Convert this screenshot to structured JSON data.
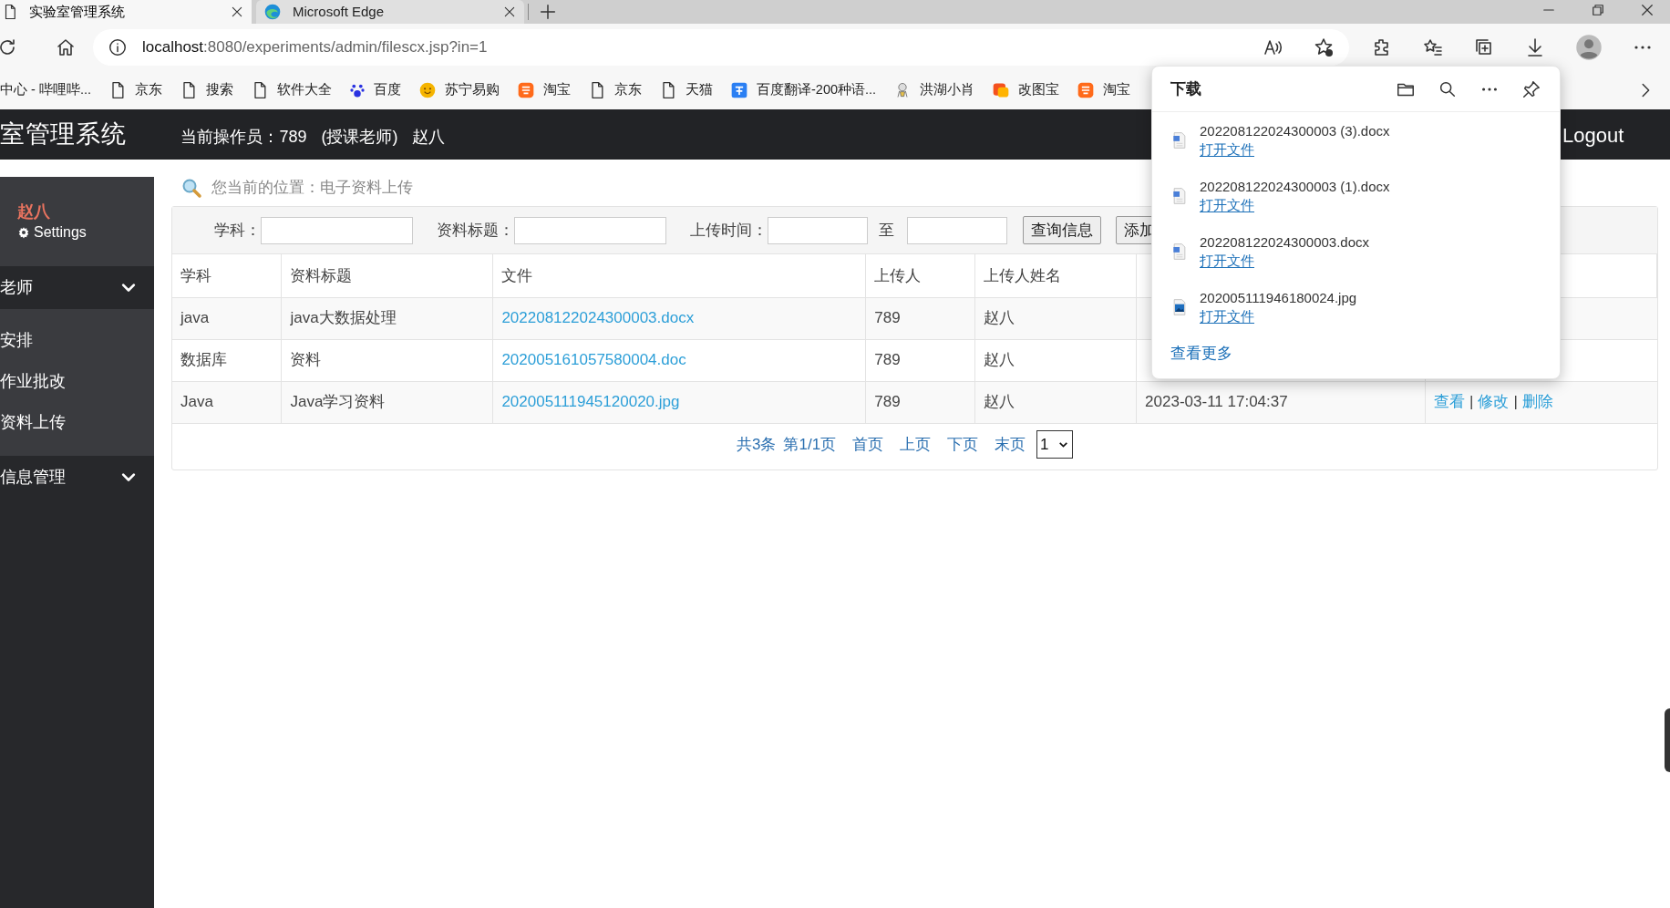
{
  "browser": {
    "tabs": [
      {
        "title": "实验室管理系统",
        "selected": true,
        "kind": "page"
      },
      {
        "title": "Microsoft Edge",
        "selected": false,
        "kind": "edge"
      }
    ],
    "address": {
      "host": "localhost",
      "path": ":8080/experiments/admin/filescx.jsp?in=1"
    },
    "bookmarks": [
      {
        "label": "中心 - 哔哩哔...",
        "kind": "none"
      },
      {
        "label": "京东",
        "kind": "page"
      },
      {
        "label": "搜索",
        "kind": "page"
      },
      {
        "label": "软件大全",
        "kind": "page"
      },
      {
        "label": "百度",
        "kind": "paw"
      },
      {
        "label": "苏宁易购",
        "kind": "smiley"
      },
      {
        "label": "淘宝",
        "kind": "tao"
      },
      {
        "label": "京东",
        "kind": "page"
      },
      {
        "label": "天猫",
        "kind": "page"
      },
      {
        "label": "百度翻译-200种语...",
        "kind": "translate"
      },
      {
        "label": "洪湖小肖",
        "kind": "figure"
      },
      {
        "label": "改图宝",
        "kind": "square"
      },
      {
        "label": "淘宝",
        "kind": "tao"
      }
    ]
  },
  "header": {
    "title": "室管理系统",
    "operator": "当前操作员：789",
    "role": "(授课老师)",
    "name": "赵八",
    "logout": "Logout"
  },
  "sidebar": {
    "user": "赵八",
    "settings": "Settings",
    "groups": [
      {
        "label": "老师",
        "items": [
          "安排",
          "作业批改",
          "资料上传"
        ]
      },
      {
        "label": "信息管理"
      }
    ]
  },
  "breadcrumb": "您当前的位置：电子资料上传",
  "search": {
    "fields": [
      {
        "label": "学科："
      },
      {
        "label": "资料标题："
      },
      {
        "label": "上传时间："
      },
      {
        "label": "至"
      }
    ],
    "buttons": [
      "查询信息",
      "添加"
    ]
  },
  "table": {
    "columns": [
      "学科",
      "资料标题",
      "文件",
      "上传人",
      "上传人姓名"
    ],
    "rows": [
      {
        "subject": "java",
        "title": "java大数据处理",
        "file": "202208122024300003.docx",
        "uploader": "789",
        "name": "赵八"
      },
      {
        "subject": "数据库",
        "title": "资料",
        "file": "202005161057580004.doc",
        "uploader": "789",
        "name": "赵八"
      },
      {
        "subject": "Java",
        "title": "Java学习资料",
        "file": "202005111945120020.jpg",
        "uploader": "789",
        "name": "赵八",
        "time": "2023-03-11 17:04:37",
        "actions": [
          "查看",
          "修改",
          "删除"
        ],
        "separator": "|"
      }
    ]
  },
  "pagination": {
    "summary": "共3条",
    "page": "第1/1页",
    "links": [
      "首页",
      "上页",
      "下页",
      "末页"
    ],
    "select": "1"
  },
  "downloads": {
    "title": "下载",
    "items": [
      {
        "name": "202208122024300003 (3).docx",
        "action": "打开文件",
        "kind": "doc"
      },
      {
        "name": "202208122024300003 (1).docx",
        "action": "打开文件",
        "kind": "doc"
      },
      {
        "name": "202208122024300003.docx",
        "action": "打开文件",
        "kind": "doc"
      },
      {
        "name": "202005111946180024.jpg",
        "action": "打开文件",
        "kind": "image"
      }
    ],
    "more": "查看更多"
  }
}
